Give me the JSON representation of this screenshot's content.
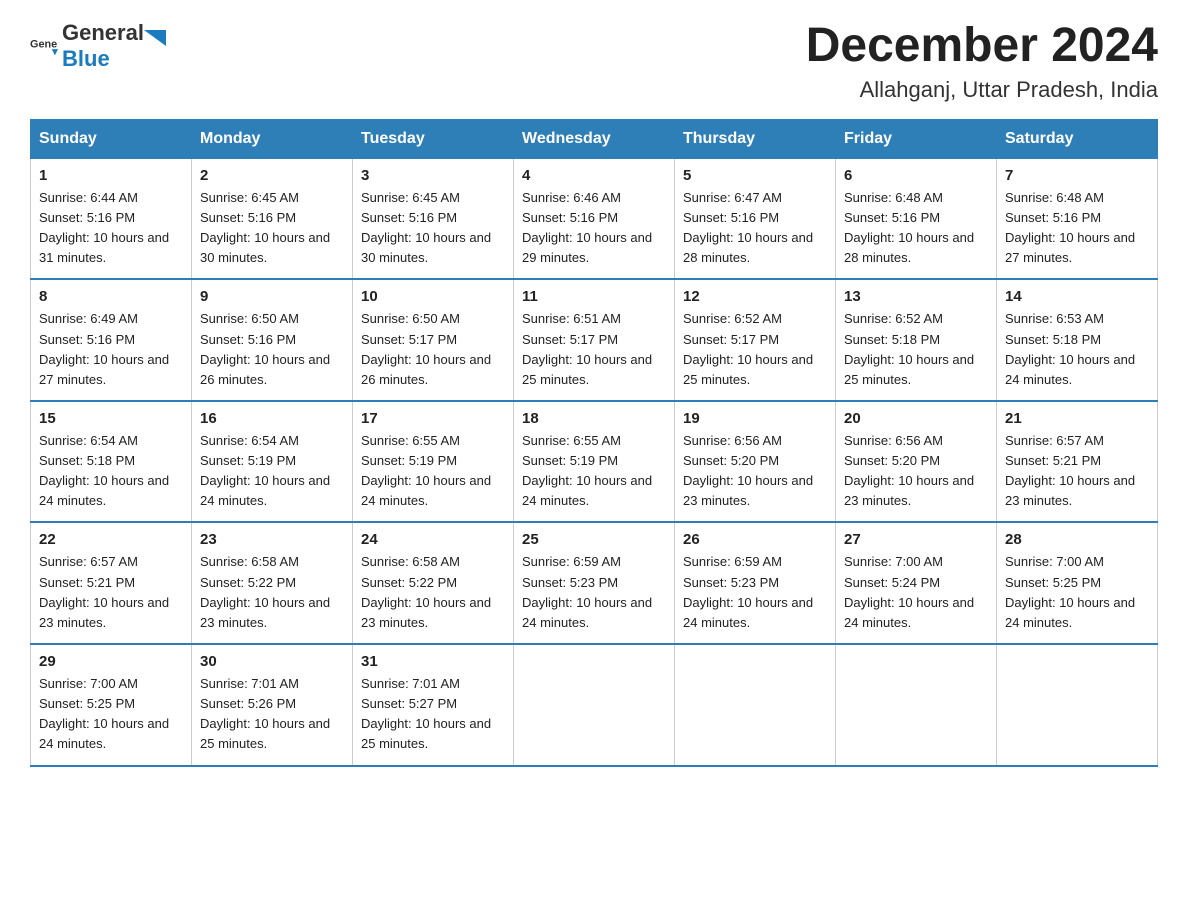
{
  "logo": {
    "text_general": "General",
    "text_blue": "Blue"
  },
  "header": {
    "month_year": "December 2024",
    "location": "Allahganj, Uttar Pradesh, India"
  },
  "days_of_week": [
    "Sunday",
    "Monday",
    "Tuesday",
    "Wednesday",
    "Thursday",
    "Friday",
    "Saturday"
  ],
  "weeks": [
    [
      {
        "day": "1",
        "sunrise": "6:44 AM",
        "sunset": "5:16 PM",
        "daylight": "10 hours and 31 minutes."
      },
      {
        "day": "2",
        "sunrise": "6:45 AM",
        "sunset": "5:16 PM",
        "daylight": "10 hours and 30 minutes."
      },
      {
        "day": "3",
        "sunrise": "6:45 AM",
        "sunset": "5:16 PM",
        "daylight": "10 hours and 30 minutes."
      },
      {
        "day": "4",
        "sunrise": "6:46 AM",
        "sunset": "5:16 PM",
        "daylight": "10 hours and 29 minutes."
      },
      {
        "day": "5",
        "sunrise": "6:47 AM",
        "sunset": "5:16 PM",
        "daylight": "10 hours and 28 minutes."
      },
      {
        "day": "6",
        "sunrise": "6:48 AM",
        "sunset": "5:16 PM",
        "daylight": "10 hours and 28 minutes."
      },
      {
        "day": "7",
        "sunrise": "6:48 AM",
        "sunset": "5:16 PM",
        "daylight": "10 hours and 27 minutes."
      }
    ],
    [
      {
        "day": "8",
        "sunrise": "6:49 AM",
        "sunset": "5:16 PM",
        "daylight": "10 hours and 27 minutes."
      },
      {
        "day": "9",
        "sunrise": "6:50 AM",
        "sunset": "5:16 PM",
        "daylight": "10 hours and 26 minutes."
      },
      {
        "day": "10",
        "sunrise": "6:50 AM",
        "sunset": "5:17 PM",
        "daylight": "10 hours and 26 minutes."
      },
      {
        "day": "11",
        "sunrise": "6:51 AM",
        "sunset": "5:17 PM",
        "daylight": "10 hours and 25 minutes."
      },
      {
        "day": "12",
        "sunrise": "6:52 AM",
        "sunset": "5:17 PM",
        "daylight": "10 hours and 25 minutes."
      },
      {
        "day": "13",
        "sunrise": "6:52 AM",
        "sunset": "5:18 PM",
        "daylight": "10 hours and 25 minutes."
      },
      {
        "day": "14",
        "sunrise": "6:53 AM",
        "sunset": "5:18 PM",
        "daylight": "10 hours and 24 minutes."
      }
    ],
    [
      {
        "day": "15",
        "sunrise": "6:54 AM",
        "sunset": "5:18 PM",
        "daylight": "10 hours and 24 minutes."
      },
      {
        "day": "16",
        "sunrise": "6:54 AM",
        "sunset": "5:19 PM",
        "daylight": "10 hours and 24 minutes."
      },
      {
        "day": "17",
        "sunrise": "6:55 AM",
        "sunset": "5:19 PM",
        "daylight": "10 hours and 24 minutes."
      },
      {
        "day": "18",
        "sunrise": "6:55 AM",
        "sunset": "5:19 PM",
        "daylight": "10 hours and 24 minutes."
      },
      {
        "day": "19",
        "sunrise": "6:56 AM",
        "sunset": "5:20 PM",
        "daylight": "10 hours and 23 minutes."
      },
      {
        "day": "20",
        "sunrise": "6:56 AM",
        "sunset": "5:20 PM",
        "daylight": "10 hours and 23 minutes."
      },
      {
        "day": "21",
        "sunrise": "6:57 AM",
        "sunset": "5:21 PM",
        "daylight": "10 hours and 23 minutes."
      }
    ],
    [
      {
        "day": "22",
        "sunrise": "6:57 AM",
        "sunset": "5:21 PM",
        "daylight": "10 hours and 23 minutes."
      },
      {
        "day": "23",
        "sunrise": "6:58 AM",
        "sunset": "5:22 PM",
        "daylight": "10 hours and 23 minutes."
      },
      {
        "day": "24",
        "sunrise": "6:58 AM",
        "sunset": "5:22 PM",
        "daylight": "10 hours and 23 minutes."
      },
      {
        "day": "25",
        "sunrise": "6:59 AM",
        "sunset": "5:23 PM",
        "daylight": "10 hours and 24 minutes."
      },
      {
        "day": "26",
        "sunrise": "6:59 AM",
        "sunset": "5:23 PM",
        "daylight": "10 hours and 24 minutes."
      },
      {
        "day": "27",
        "sunrise": "7:00 AM",
        "sunset": "5:24 PM",
        "daylight": "10 hours and 24 minutes."
      },
      {
        "day": "28",
        "sunrise": "7:00 AM",
        "sunset": "5:25 PM",
        "daylight": "10 hours and 24 minutes."
      }
    ],
    [
      {
        "day": "29",
        "sunrise": "7:00 AM",
        "sunset": "5:25 PM",
        "daylight": "10 hours and 24 minutes."
      },
      {
        "day": "30",
        "sunrise": "7:01 AM",
        "sunset": "5:26 PM",
        "daylight": "10 hours and 25 minutes."
      },
      {
        "day": "31",
        "sunrise": "7:01 AM",
        "sunset": "5:27 PM",
        "daylight": "10 hours and 25 minutes."
      },
      null,
      null,
      null,
      null
    ]
  ]
}
